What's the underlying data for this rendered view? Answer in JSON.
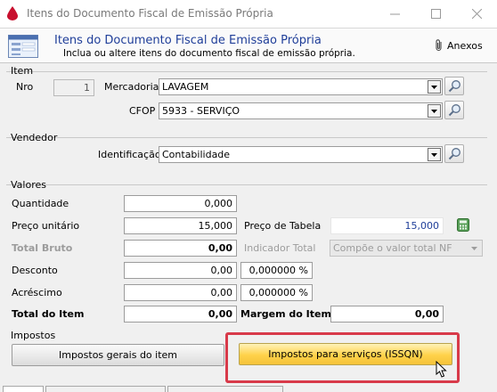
{
  "window": {
    "title": "Itens do Documento Fiscal de Emissão Própria"
  },
  "header": {
    "title": "Itens do Documento Fiscal de Emissão Própria",
    "subtitle": "Inclua ou altere itens do documento fiscal de emissão própria.",
    "attachments_label": "Anexos"
  },
  "item": {
    "section_title": "Item",
    "nro_label": "Nro",
    "nro_value": "1",
    "mercadoria_label": "Mercadoria",
    "mercadoria_value": "LAVAGEM",
    "cfop_label": "CFOP",
    "cfop_value": "5933  - SERVIÇO"
  },
  "vendedor": {
    "section_title": "Vendedor",
    "identificacao_label": "Identificação",
    "identificacao_value": "Contabilidade"
  },
  "valores": {
    "section_title": "Valores",
    "quantidade_label": "Quantidade",
    "quantidade_value": "0,000",
    "preco_unitario_label": "Preço unitário",
    "preco_unitario_value": "15,000",
    "preco_tabela_label": "Preço de Tabela",
    "preco_tabela_value": "15,000",
    "total_bruto_label": "Total Bruto",
    "total_bruto_value": "0,00",
    "indicador_total_label": "Indicador Total",
    "indicador_total_value": "Compõe o valor total NF",
    "desconto_label": "Desconto",
    "desconto_value": "0,00",
    "desconto_pct": "0,000000 %",
    "acrescimo_label": "Acréscimo",
    "acrescimo_value": "0,00",
    "acrescimo_pct": "0,000000 %",
    "total_item_label": "Total do Item",
    "total_item_value": "0,00",
    "margem_label": "Margem do Item",
    "margem_value": "0,00"
  },
  "impostos": {
    "section_title": "Impostos",
    "gerais_button": "Impostos gerais do item",
    "servicos_button": "Impostos para serviços (ISSQN)"
  },
  "colors": {
    "accent_title": "#1f3e99",
    "highlight": "#d83a4a",
    "button_yellow": "#ffd24a"
  },
  "icons": [
    "app-drop-icon",
    "minimize-icon",
    "maximize-icon",
    "close-icon",
    "form-icon",
    "paperclip-icon",
    "search-icon",
    "chevron-down-icon",
    "calculator-icon",
    "mouse-cursor-icon"
  ]
}
